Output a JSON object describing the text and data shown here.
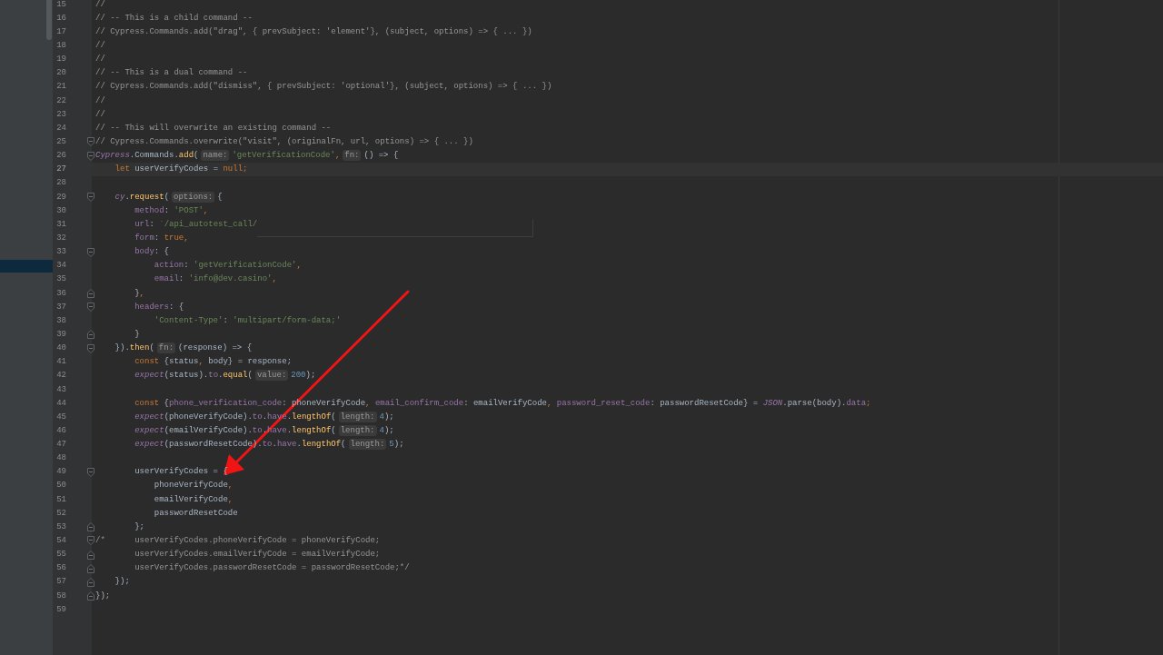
{
  "editor": {
    "lines": [
      {
        "number": "15",
        "tokens": [
          {
            "text": "//",
            "kind": "comment"
          }
        ]
      },
      {
        "number": "16",
        "tokens": [
          {
            "text": "// -- This is a child command --",
            "kind": "comment"
          }
        ]
      },
      {
        "number": "17",
        "tokens": [
          {
            "text": "// Cypress.Commands.add(\"drag\", { prevSubject: 'element'}, (subject, options) => { ... })",
            "kind": "comment"
          }
        ]
      },
      {
        "number": "18",
        "tokens": [
          {
            "text": "//",
            "kind": "comment"
          }
        ]
      },
      {
        "number": "19",
        "tokens": [
          {
            "text": "//",
            "kind": "comment"
          }
        ]
      },
      {
        "number": "20",
        "tokens": [
          {
            "text": "// -- This is a dual command --",
            "kind": "comment"
          }
        ]
      },
      {
        "number": "21",
        "tokens": [
          {
            "text": "// Cypress.Commands.add(\"dismiss\", { prevSubject: 'optional'}, (subject, options) => { ... })",
            "kind": "comment"
          }
        ]
      },
      {
        "number": "22",
        "tokens": [
          {
            "text": "//",
            "kind": "comment"
          }
        ]
      },
      {
        "number": "23",
        "tokens": [
          {
            "text": "//",
            "kind": "comment"
          }
        ]
      },
      {
        "number": "24",
        "tokens": [
          {
            "text": "// -- This will overwrite an existing command --",
            "kind": "comment"
          }
        ]
      },
      {
        "number": "25",
        "fold_start": true,
        "tokens": [
          {
            "text": "// Cypress.Commands.overwrite(\"visit\", (originalFn, url, options) => { ... })",
            "kind": "comment"
          }
        ]
      },
      {
        "number": "26",
        "fold_start": true,
        "tokens": [
          {
            "text": "Cypress",
            "kind": "global"
          },
          {
            "text": ".Commands.",
            "kind": "plain"
          },
          {
            "text": "add",
            "kind": "func"
          },
          {
            "text": "(",
            "kind": "plain"
          },
          {
            "text": "name:",
            "kind": "hint"
          },
          {
            "text": "'getVerificationCode'",
            "kind": "string"
          },
          {
            "text": ",",
            "kind": "keyword"
          },
          {
            "text": "fn:",
            "kind": "hint"
          },
          {
            "text": "() => {",
            "kind": "plain"
          }
        ]
      },
      {
        "number": "27",
        "current": true,
        "tokens": [
          {
            "text": "    let",
            "kind": "keyword"
          },
          {
            "text": " userVerifyCodes = ",
            "kind": "plain"
          },
          {
            "text": "null;",
            "kind": "keyword"
          }
        ]
      },
      {
        "number": "28"
      },
      {
        "number": "29",
        "fold_start": true,
        "tokens": [
          {
            "text": "    cy",
            "kind": "global"
          },
          {
            "text": ".",
            "kind": "plain"
          },
          {
            "text": "request",
            "kind": "func"
          },
          {
            "text": "(",
            "kind": "plain"
          },
          {
            "text": "options:",
            "kind": "hint"
          },
          {
            "text": "{",
            "kind": "plain"
          }
        ]
      },
      {
        "number": "30",
        "tokens": [
          {
            "text": "        method",
            "kind": "prop"
          },
          {
            "text": ": ",
            "kind": "plain"
          },
          {
            "text": "'POST'",
            "kind": "string"
          },
          {
            "text": ",",
            "kind": "keyword"
          }
        ]
      },
      {
        "number": "31",
        "popup": true,
        "tokens": [
          {
            "text": "        url",
            "kind": "prop"
          },
          {
            "text": ": ",
            "kind": "plain"
          },
          {
            "text": "`/api_autotest_call/",
            "kind": "string"
          }
        ]
      },
      {
        "number": "32",
        "tokens": [
          {
            "text": "        form",
            "kind": "prop"
          },
          {
            "text": ": ",
            "kind": "plain"
          },
          {
            "text": "true,",
            "kind": "keyword"
          }
        ]
      },
      {
        "number": "33",
        "fold_start": true,
        "tokens": [
          {
            "text": "        body",
            "kind": "prop"
          },
          {
            "text": ": {",
            "kind": "plain"
          }
        ]
      },
      {
        "number": "34",
        "tokens": [
          {
            "text": "            action",
            "kind": "prop"
          },
          {
            "text": ": ",
            "kind": "plain"
          },
          {
            "text": "'getVerificationCode'",
            "kind": "string"
          },
          {
            "text": ",",
            "kind": "keyword"
          }
        ]
      },
      {
        "number": "35",
        "tokens": [
          {
            "text": "            email",
            "kind": "prop"
          },
          {
            "text": ": ",
            "kind": "plain"
          },
          {
            "text": "'info@dev.casino'",
            "kind": "string"
          },
          {
            "text": ",",
            "kind": "keyword"
          }
        ]
      },
      {
        "number": "36",
        "fold_end": true,
        "tokens": [
          {
            "text": "        }",
            "kind": "plain"
          },
          {
            "text": ",",
            "kind": "keyword"
          }
        ]
      },
      {
        "number": "37",
        "fold_start": true,
        "tokens": [
          {
            "text": "        headers",
            "kind": "prop"
          },
          {
            "text": ": {",
            "kind": "plain"
          }
        ]
      },
      {
        "number": "38",
        "tokens": [
          {
            "text": "            'Content-Type'",
            "kind": "string"
          },
          {
            "text": ": ",
            "kind": "plain"
          },
          {
            "text": "'multipart/form-data;'",
            "kind": "string"
          }
        ]
      },
      {
        "number": "39",
        "fold_end": true,
        "tokens": [
          {
            "text": "        }",
            "kind": "plain"
          }
        ]
      },
      {
        "number": "40",
        "fold_start": true,
        "tokens": [
          {
            "text": "    }).",
            "kind": "plain"
          },
          {
            "text": "then",
            "kind": "func"
          },
          {
            "text": "(",
            "kind": "plain"
          },
          {
            "text": "fn:",
            "kind": "hint"
          },
          {
            "text": "(response) => {",
            "kind": "plain"
          }
        ]
      },
      {
        "number": "41",
        "tokens": [
          {
            "text": "        const",
            "kind": "keyword"
          },
          {
            "text": " {status",
            "kind": "plain"
          },
          {
            "text": ",",
            "kind": "keyword"
          },
          {
            "text": " body} = response;",
            "kind": "plain"
          }
        ]
      },
      {
        "number": "42",
        "tokens": [
          {
            "text": "        expect",
            "kind": "global"
          },
          {
            "text": "(status).",
            "kind": "plain"
          },
          {
            "text": "to",
            "kind": "prop"
          },
          {
            "text": ".",
            "kind": "plain"
          },
          {
            "text": "equal",
            "kind": "func"
          },
          {
            "text": "(",
            "kind": "plain"
          },
          {
            "text": "value:",
            "kind": "hint"
          },
          {
            "text": "200",
            "kind": "number"
          },
          {
            "text": ");",
            "kind": "plain"
          }
        ]
      },
      {
        "number": "43"
      },
      {
        "number": "44",
        "tokens": [
          {
            "text": "        const",
            "kind": "keyword"
          },
          {
            "text": " {",
            "kind": "plain"
          },
          {
            "text": "phone_verification_code",
            "kind": "prop"
          },
          {
            "text": ": phoneVerifyCode",
            "kind": "plain"
          },
          {
            "text": ", ",
            "kind": "keyword"
          },
          {
            "text": "email_confirm_code",
            "kind": "prop"
          },
          {
            "text": ": emailVerifyCode",
            "kind": "plain"
          },
          {
            "text": ", ",
            "kind": "keyword"
          },
          {
            "text": "password_reset_code",
            "kind": "prop"
          },
          {
            "text": ": passwordResetCode} = ",
            "kind": "plain"
          },
          {
            "text": "JSON",
            "kind": "global"
          },
          {
            "text": ".parse(body).",
            "kind": "plain"
          },
          {
            "text": "data",
            "kind": "prop"
          },
          {
            "text": ";",
            "kind": "keyword"
          }
        ]
      },
      {
        "number": "45",
        "tokens": [
          {
            "text": "        expect",
            "kind": "global"
          },
          {
            "text": "(phoneVerifyCode).",
            "kind": "plain"
          },
          {
            "text": "to",
            "kind": "prop"
          },
          {
            "text": ".",
            "kind": "plain"
          },
          {
            "text": "have",
            "kind": "prop"
          },
          {
            "text": ".",
            "kind": "plain"
          },
          {
            "text": "lengthOf",
            "kind": "func"
          },
          {
            "text": "(",
            "kind": "plain"
          },
          {
            "text": "length:",
            "kind": "hint"
          },
          {
            "text": "4",
            "kind": "number"
          },
          {
            "text": ");",
            "kind": "plain"
          }
        ]
      },
      {
        "number": "46",
        "tokens": [
          {
            "text": "        expect",
            "kind": "global"
          },
          {
            "text": "(emailVerifyCode).",
            "kind": "plain"
          },
          {
            "text": "to",
            "kind": "prop"
          },
          {
            "text": ".",
            "kind": "plain"
          },
          {
            "text": "have",
            "kind": "prop"
          },
          {
            "text": ".",
            "kind": "plain"
          },
          {
            "text": "lengthOf",
            "kind": "func"
          },
          {
            "text": "(",
            "kind": "plain"
          },
          {
            "text": "length:",
            "kind": "hint"
          },
          {
            "text": "4",
            "kind": "number"
          },
          {
            "text": ");",
            "kind": "plain"
          }
        ]
      },
      {
        "number": "47",
        "tokens": [
          {
            "text": "        expect",
            "kind": "global"
          },
          {
            "text": "(passwordResetCode).",
            "kind": "plain"
          },
          {
            "text": "to",
            "kind": "prop"
          },
          {
            "text": ".",
            "kind": "plain"
          },
          {
            "text": "have",
            "kind": "prop"
          },
          {
            "text": ".",
            "kind": "plain"
          },
          {
            "text": "lengthOf",
            "kind": "func"
          },
          {
            "text": "(",
            "kind": "plain"
          },
          {
            "text": "length:",
            "kind": "hint"
          },
          {
            "text": "5",
            "kind": "number"
          },
          {
            "text": ");",
            "kind": "plain"
          }
        ]
      },
      {
        "number": "48"
      },
      {
        "number": "49",
        "fold_start": true,
        "tokens": [
          {
            "text": "        userVerifyCodes = {",
            "kind": "plain"
          }
        ]
      },
      {
        "number": "50",
        "tokens": [
          {
            "text": "            phoneVerifyCode",
            "kind": "plain"
          },
          {
            "text": ",",
            "kind": "keyword"
          }
        ]
      },
      {
        "number": "51",
        "tokens": [
          {
            "text": "            emailVerifyCode",
            "kind": "plain"
          },
          {
            "text": ",",
            "kind": "keyword"
          }
        ]
      },
      {
        "number": "52",
        "tokens": [
          {
            "text": "            passwordResetCode",
            "kind": "plain"
          }
        ]
      },
      {
        "number": "53",
        "fold_end": true,
        "tokens": [
          {
            "text": "        };",
            "kind": "plain"
          }
        ]
      },
      {
        "number": "54",
        "fold_start": true,
        "tokens": [
          {
            "text": "/*      userVerifyCodes.phoneVerifyCode = phoneVerifyCode;",
            "kind": "comment"
          }
        ]
      },
      {
        "number": "55",
        "fold_end": true,
        "tokens": [
          {
            "text": "        userVerifyCodes.emailVerifyCode = emailVerifyCode;",
            "kind": "comment"
          }
        ]
      },
      {
        "number": "56",
        "fold_end": true,
        "tokens": [
          {
            "text": "        userVerifyCodes.passwordResetCode = passwordResetCode;*/",
            "kind": "comment"
          }
        ]
      },
      {
        "number": "57",
        "fold_end": true,
        "tokens": [
          {
            "text": "    });",
            "kind": "plain"
          }
        ]
      },
      {
        "number": "58",
        "fold_end": true,
        "tokens": [
          {
            "text": "});",
            "kind": "plain"
          }
        ]
      },
      {
        "number": "59"
      }
    ]
  }
}
